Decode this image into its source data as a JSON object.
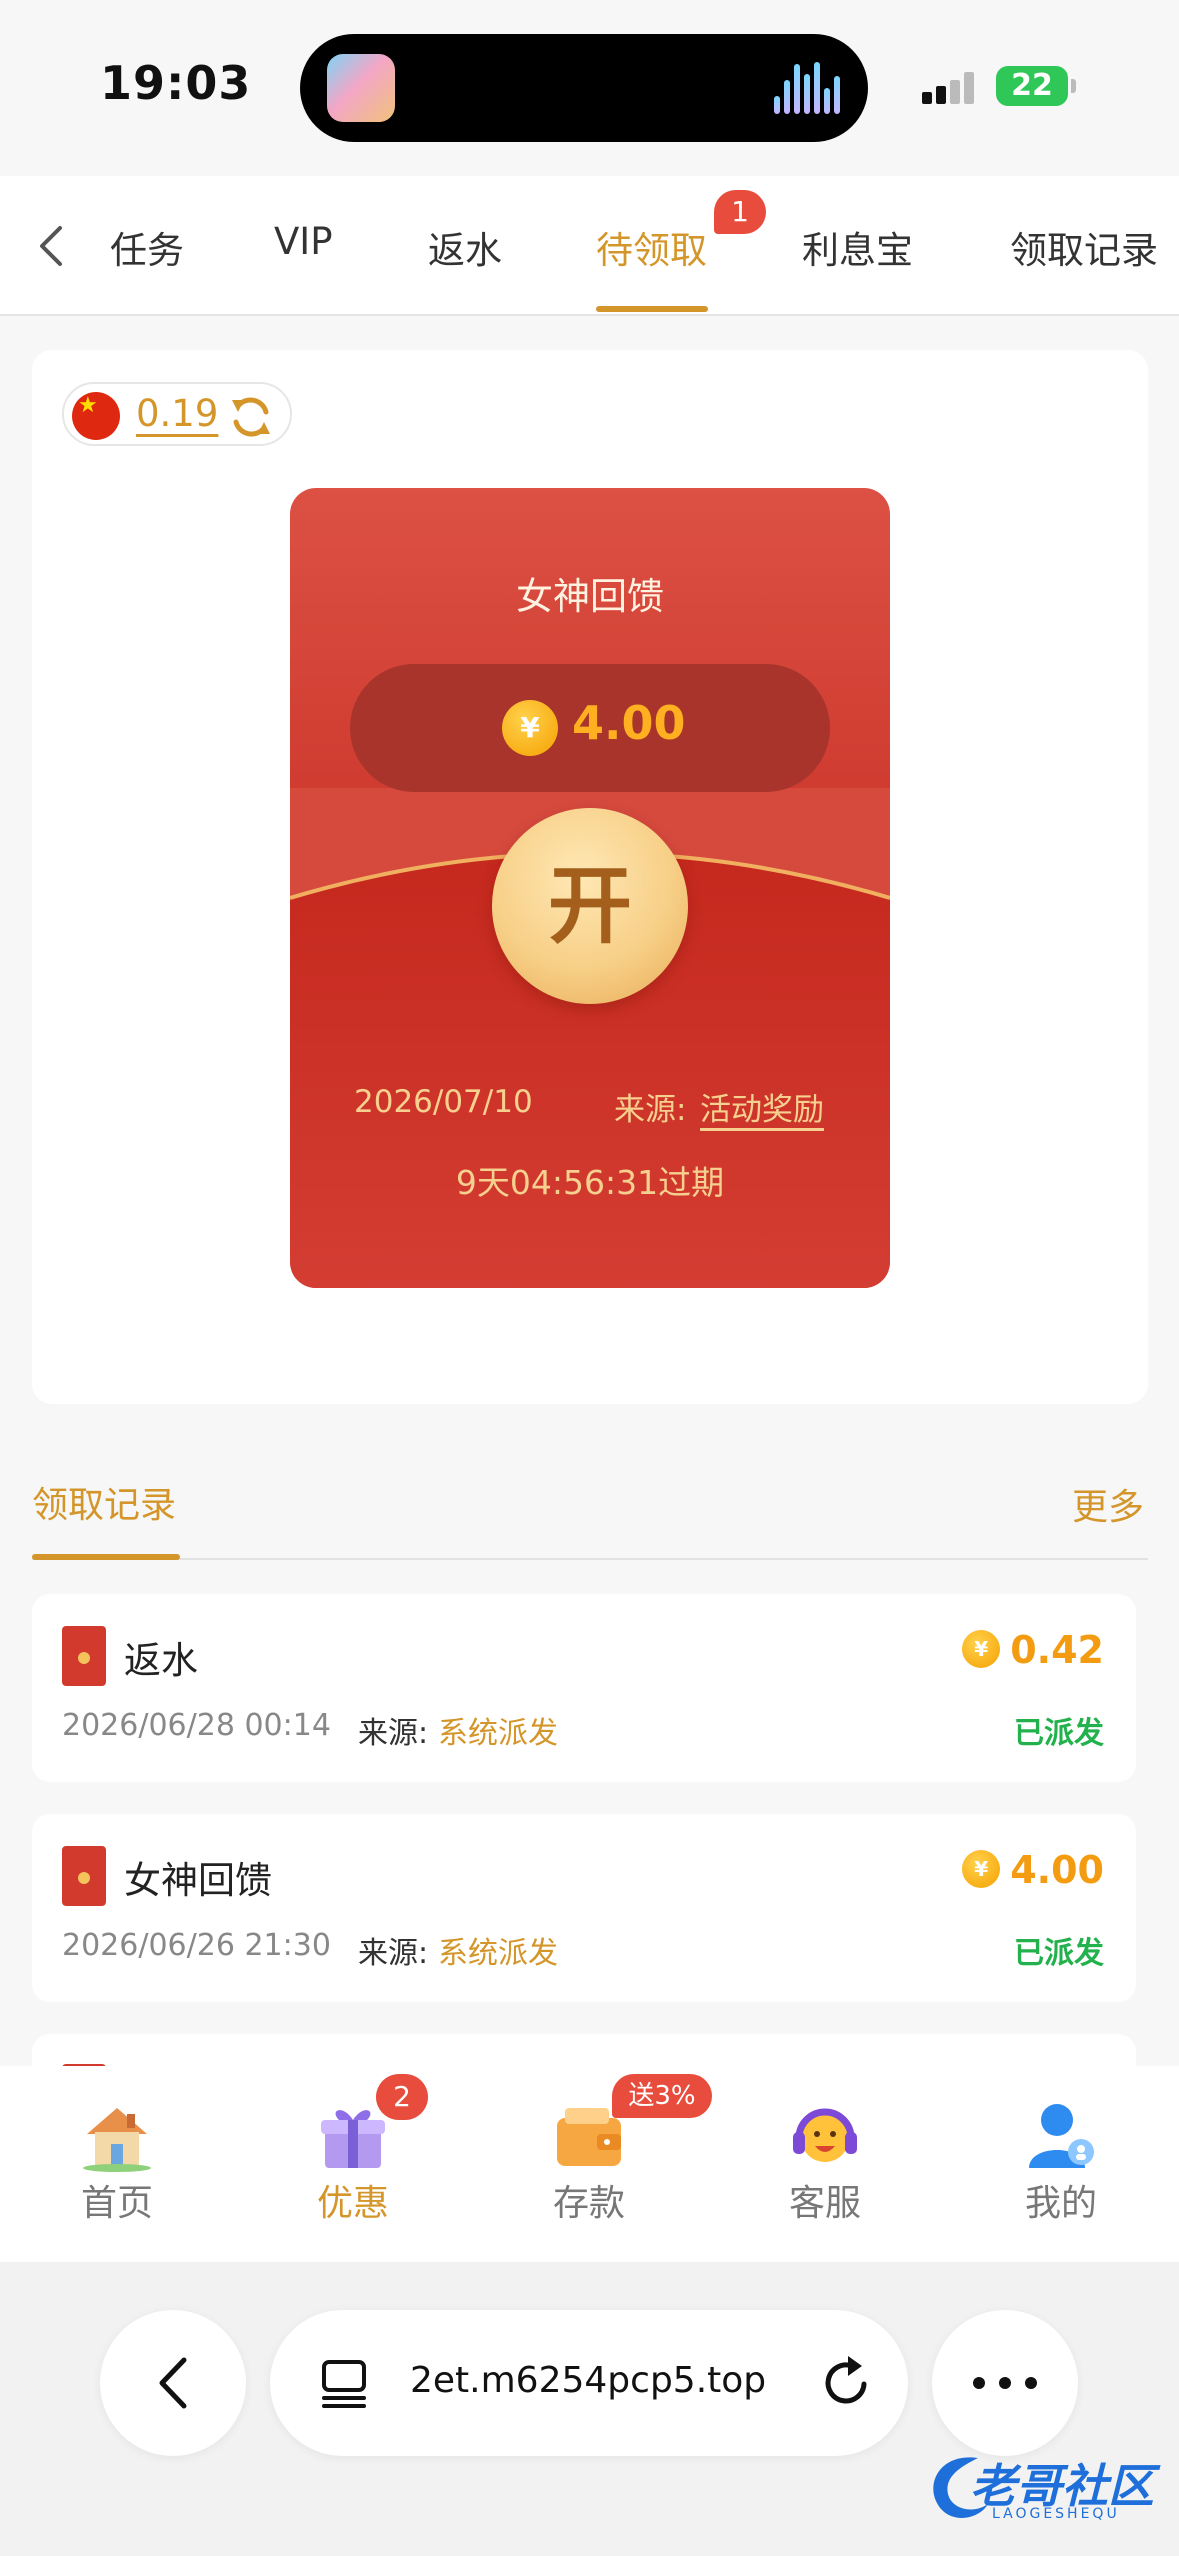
{
  "status_bar": {
    "time": "19:03",
    "battery": "22"
  },
  "tabs": {
    "items": [
      {
        "label": "任务"
      },
      {
        "label": "VIP"
      },
      {
        "label": "返水"
      },
      {
        "label": "待领取",
        "active": true
      },
      {
        "label": "利息宝"
      },
      {
        "label": "领取记录"
      }
    ],
    "badge": "1"
  },
  "balance": {
    "value": "0.19"
  },
  "envelope": {
    "title": "女神回馈",
    "amount": "4.00",
    "currency_symbol": "¥",
    "open_label": "开",
    "date": "2026/07/10",
    "source_label": "来源:",
    "source": "活动奖励",
    "expire_text": "9天04:56:31过期"
  },
  "records": {
    "title": "领取记录",
    "more": "更多",
    "items": [
      {
        "title": "返水",
        "date": "2026/06/28 00:14",
        "source_label": "来源:",
        "source": "系统派发",
        "amount": "0.42",
        "status": "已派发"
      },
      {
        "title": "女神回馈",
        "date": "2026/06/26 21:30",
        "source_label": "来源:",
        "source": "系统派发",
        "amount": "4.00",
        "status": "已派发"
      }
    ]
  },
  "bottom_nav": {
    "items": [
      {
        "label": "首页",
        "icon": "house-icon"
      },
      {
        "label": "优惠",
        "icon": "gift-icon",
        "active": true,
        "badge": "2"
      },
      {
        "label": "存款",
        "icon": "wallet-icon",
        "badge": "送3%"
      },
      {
        "label": "客服",
        "icon": "headset-icon"
      },
      {
        "label": "我的",
        "icon": "user-icon"
      }
    ]
  },
  "browser": {
    "url": "2et.m6254pcp5.top"
  },
  "watermark": {
    "text": "老哥社区",
    "sub": "LAOGESHEQU"
  },
  "colors": {
    "accent": "#d4962a",
    "envelope_red": "#cf3a2f",
    "success": "#22b14c",
    "badge": "#e74c3c",
    "amount": "#f39c12"
  }
}
